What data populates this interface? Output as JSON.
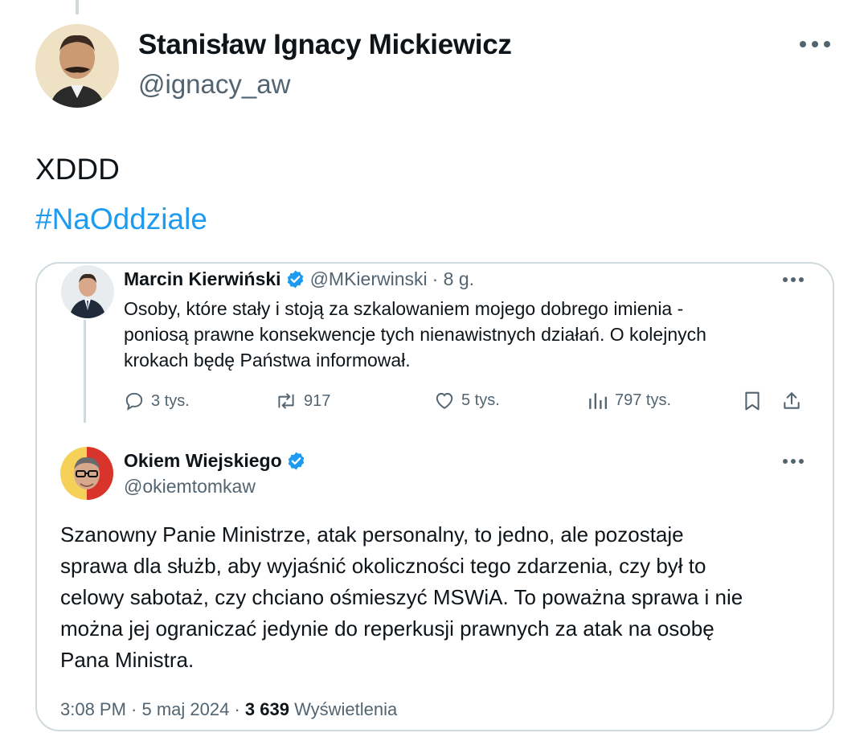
{
  "tweet": {
    "author": {
      "name": "Stanisław Ignacy Mickiewicz",
      "handle": "@ignacy_aw"
    },
    "text": "XDDD",
    "hashtag": "#NaOddziale"
  },
  "quote": {
    "parent": {
      "name": "Marcin Kierwiński",
      "handle": "@MKierwinski",
      "time": "· 8 g.",
      "lines": [
        "Osoby, które stały i stoją za szkalowaniem mojego dobrego imienia -",
        "poniosą prawne konsekwencje tych nienawistnych działań. O kolejnych",
        "krokach będę Państwa informował."
      ],
      "actions": {
        "replies": "3 tys.",
        "reposts": "917",
        "likes": "5 tys.",
        "views": "797 tys."
      }
    },
    "reply": {
      "name": "Okiem Wiejskiego",
      "handle": "@okiemtomkaw",
      "lines": [
        "Szanowny Panie Ministrze, atak personalny, to jedno, ale pozostaje",
        "sprawa dla służb, aby wyjaśnić okoliczności tego zdarzenia, czy był to",
        "celowy sabotaż, czy chciano ośmieszyć MSWiA. To poważna sprawa i nie",
        "można jej ograniczać jedynie do reperkusji prawnych za atak na osobę",
        "Pana Ministra."
      ],
      "meta": {
        "time_date": "3:08 PM · 5 maj 2024 · ",
        "views_count": "3 639",
        "views_label": " Wyświetlenia"
      }
    }
  },
  "colors": {
    "link": "#1d9bf0",
    "secondary": "#536471",
    "border": "#cfd9de",
    "verified": "#1d9bf0"
  },
  "icons": [
    "more-icon",
    "verified-badge-icon",
    "reply-icon",
    "repost-icon",
    "like-icon",
    "views-icon",
    "bookmark-icon",
    "share-icon"
  ]
}
